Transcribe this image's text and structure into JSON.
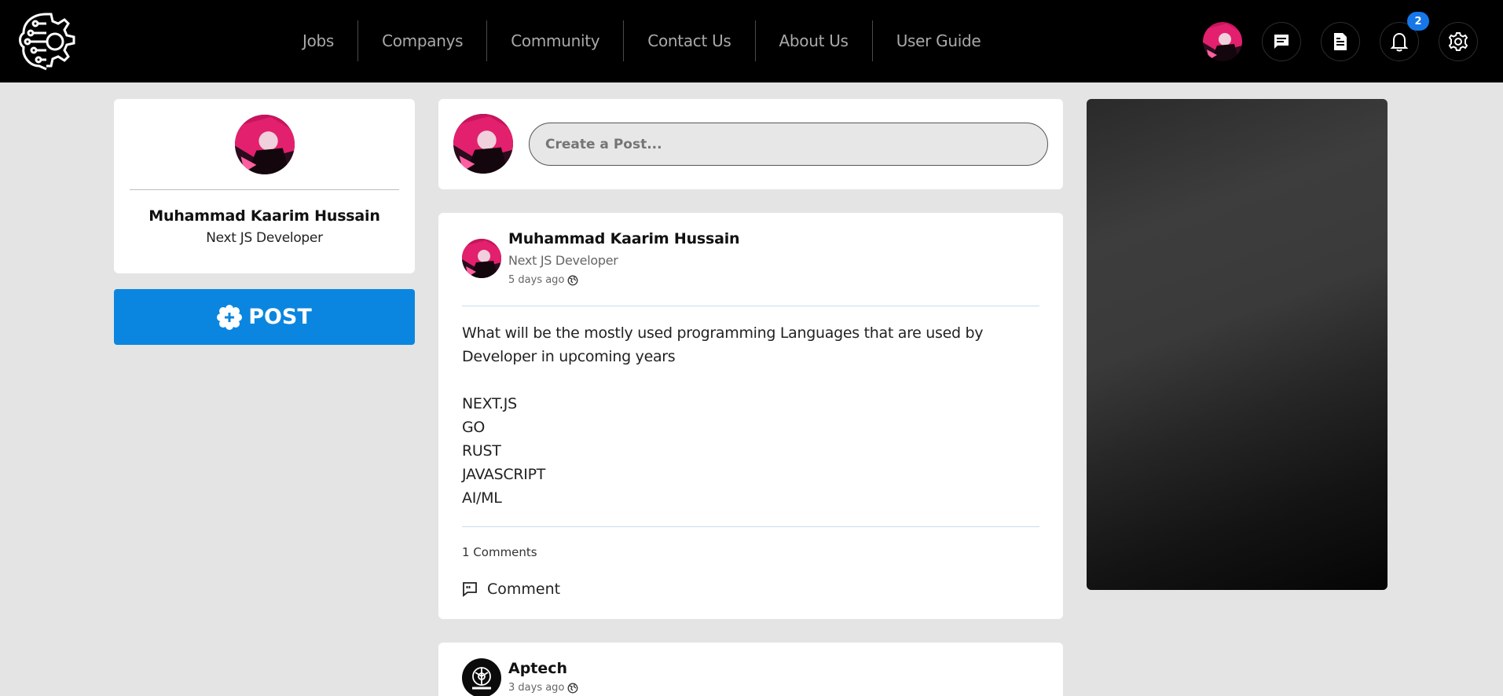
{
  "topnav": {
    "links": [
      "Jobs",
      "Companys",
      "Community",
      "Contact Us",
      "About Us",
      "User Guide"
    ],
    "icons": [
      "avatar",
      "message-icon",
      "document-icon",
      "bell-icon",
      "gear-icon"
    ],
    "notification_count": "2"
  },
  "profile": {
    "name": "Muhammad Kaarim Hussain",
    "role": "Next JS Developer"
  },
  "post_button": {
    "label": "POST"
  },
  "create_post": {
    "placeholder": "Create a Post..."
  },
  "feed": [
    {
      "author": "Muhammad Kaarim Hussain",
      "role": "Next JS Developer",
      "time": "5 days ago",
      "body_intro": "What will be the mostly used programming Languages that are used by Developer in upcoming years",
      "body_list": [
        "NEXT.JS",
        "GO",
        "RUST",
        "JAVASCRIPT",
        "AI/ML"
      ],
      "comments_count": "1 Comments",
      "comment_label": "Comment"
    },
    {
      "author": "Aptech",
      "time": "3 days ago"
    }
  ],
  "colors": {
    "topbar": "#000000",
    "accent": "#0a86e0",
    "badge": "#1677e8",
    "background": "#e4e4e4"
  }
}
